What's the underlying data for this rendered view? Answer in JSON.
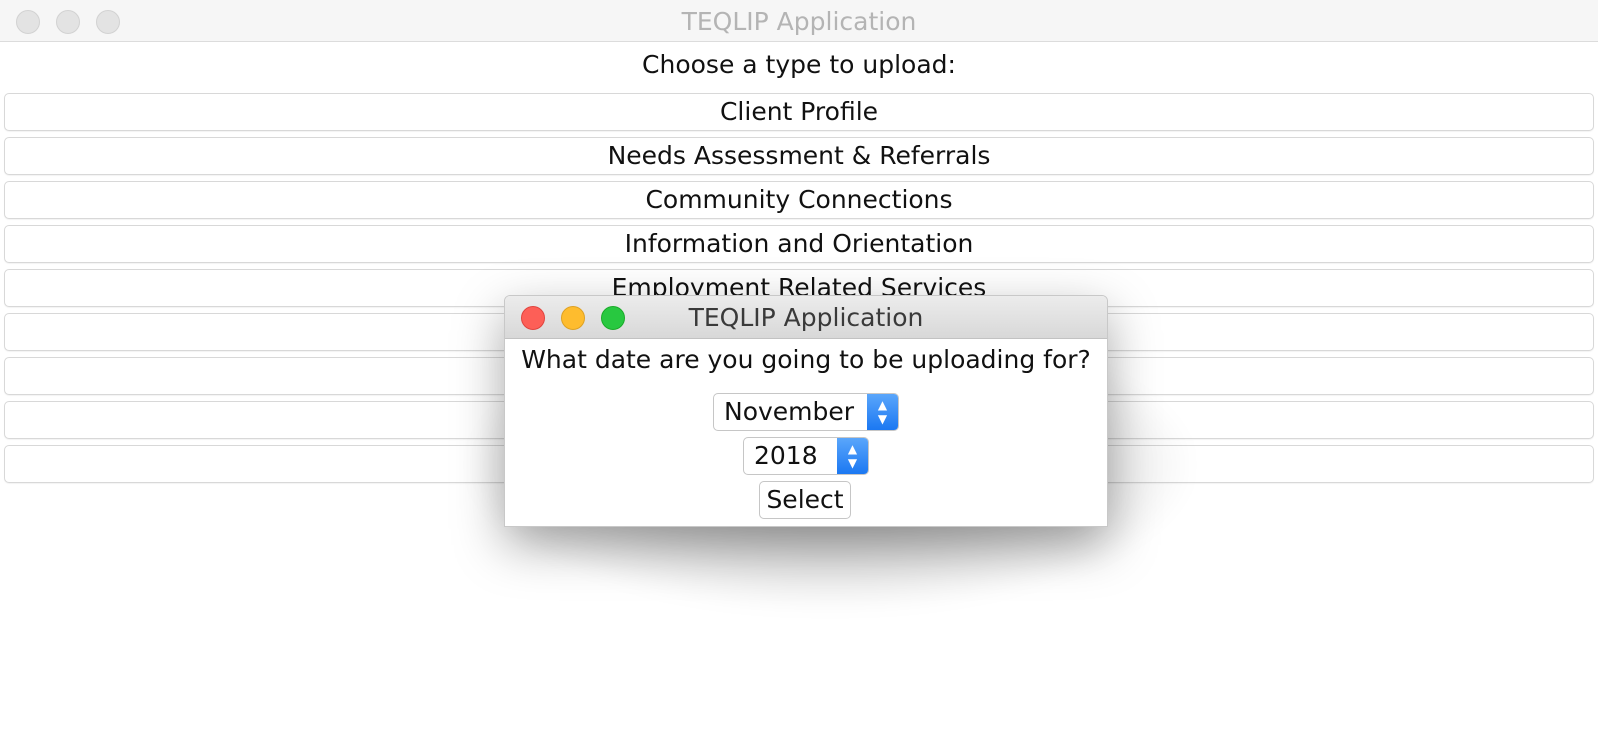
{
  "main_window": {
    "title": "TEQLIP Application",
    "prompt": "Choose a type to upload:",
    "types": [
      "Client Profile",
      "Needs Assessment & Referrals",
      "Community Connections",
      "Information and Orientation",
      "Employment Related Services",
      "",
      "",
      "",
      ""
    ]
  },
  "dialog": {
    "title": "TEQLIP Application",
    "question": "What date are you going to be uploading for?",
    "month": {
      "selected": "November"
    },
    "year": {
      "selected": "2018"
    },
    "select_label": "Select"
  },
  "colors": {
    "close": "#fd5f57",
    "minimize": "#febc2e",
    "zoom": "#28c840",
    "stepper": "#2a84f5"
  },
  "icons": {
    "stepper": "up-down-chevron-icon"
  }
}
